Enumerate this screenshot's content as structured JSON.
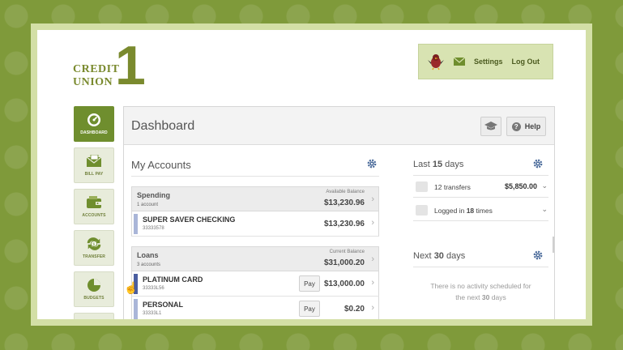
{
  "logo": {
    "word1": "CREDIT",
    "word2": "UNION",
    "numeral": "1"
  },
  "topbar": {
    "settings": "Settings",
    "logout": "Log Out"
  },
  "sidebar": [
    {
      "label": "DASHBOARD",
      "icon": "dashboard-gauge-icon"
    },
    {
      "label": "BILL PAY",
      "icon": "bill-pay-envelope-icon"
    },
    {
      "label": "ACCOUNTS",
      "icon": "accounts-wallet-icon"
    },
    {
      "label": "TRANSFER",
      "icon": "transfer-arrows-icon"
    },
    {
      "label": "BUDGETS",
      "icon": "budgets-pie-icon"
    }
  ],
  "panel": {
    "title": "Dashboard",
    "help": "Help"
  },
  "accounts": {
    "title": "My Accounts",
    "groups": [
      {
        "name": "Spending",
        "sub": "1 account",
        "caption": "Available Balance",
        "balance": "$13,230.96",
        "items": [
          {
            "name": "SUPER SAVER CHECKING",
            "number": "33333578",
            "amount": "$13,230.96",
            "pay": ""
          }
        ]
      },
      {
        "name": "Loans",
        "sub": "3 accounts",
        "caption": "Current Balance",
        "balance": "$31,000.20",
        "items": [
          {
            "name": "PLATINUM CARD",
            "number": "33333L56",
            "amount": "$13,000.00",
            "pay": "Pay"
          },
          {
            "name": "PERSONAL",
            "number": "33333L1",
            "amount": "$0.20",
            "pay": "Pay"
          }
        ]
      }
    ]
  },
  "last": {
    "pre": "Last ",
    "num": "15",
    "post": " days",
    "rows": [
      {
        "count": "12",
        "label": " transfers",
        "amount": "$5,850.00"
      },
      {
        "pre": "Logged in ",
        "count": "18",
        "post": " times"
      }
    ]
  },
  "next": {
    "pre": "Next ",
    "num": "30",
    "post": " days",
    "empty_line1": "There is no activity scheduled for",
    "empty_pre": "the next ",
    "empty_num": "30",
    "empty_post": " days"
  },
  "colors": {
    "accent": "#6f8e2e",
    "checking_bar": "#aab6d8",
    "card_bar": "#4a5ea0",
    "personal_bar": "#aab6d8",
    "gear": "#4a6a9a"
  }
}
